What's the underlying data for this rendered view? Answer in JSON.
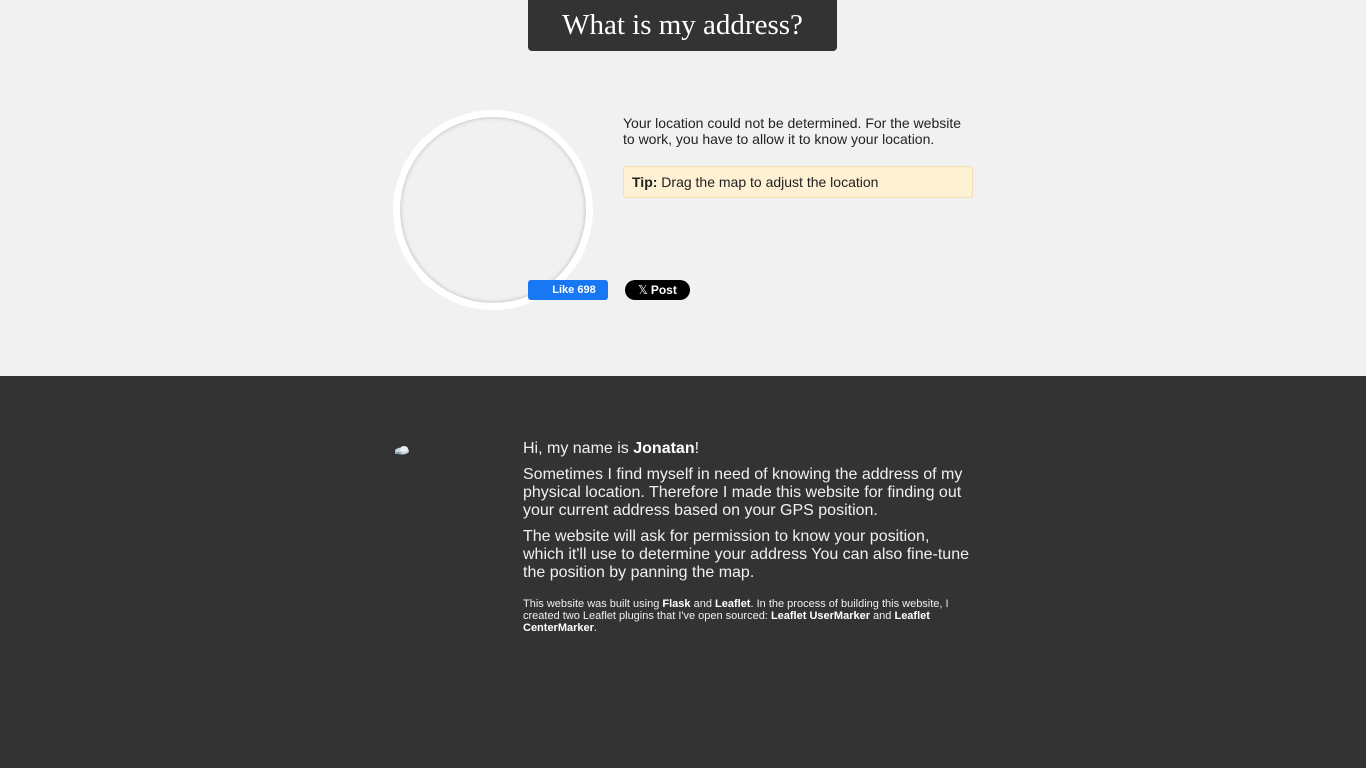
{
  "header": {
    "title": "What is my address?"
  },
  "main": {
    "location_message": "Your location could not be determined. For the website to work, you have to allow it to know your location.",
    "tip_label": "Tip:",
    "tip_text": "Drag the map to adjust the location"
  },
  "footer": {
    "greeting_prefix": "Hi, my name is ",
    "author_name": "Jonatan",
    "greeting_suffix": "!",
    "paragraph1": "Sometimes I find myself in need of knowing the address of my physical location. Therefore I made this website for finding out your current address based on your GPS position.",
    "paragraph2": "The website will ask for permission to know your position, which it'll use to determine your address You can also fine-tune the position by panning the map.",
    "credits": {
      "t1": "This website was built using ",
      "flask": "Flask",
      "t2": " and ",
      "leaflet": "Leaflet",
      "t3": ". In the process of building this website, I created two Leaflet plugins that I've open sourced: ",
      "usermarker": "Leaflet UserMarker",
      "t4": " and ",
      "centermarker": "Leaflet CenterMarker",
      "t5": "."
    },
    "like_label": "Like 698",
    "post_label": "Post",
    "x_glyph": "𝕏"
  },
  "colors": {
    "top_background": "#f1f1f1",
    "bottom_background": "#333333",
    "title_background": "#333333",
    "tip_background": "#fff1d4",
    "like_blue": "#1877f2",
    "post_black": "#000000"
  }
}
